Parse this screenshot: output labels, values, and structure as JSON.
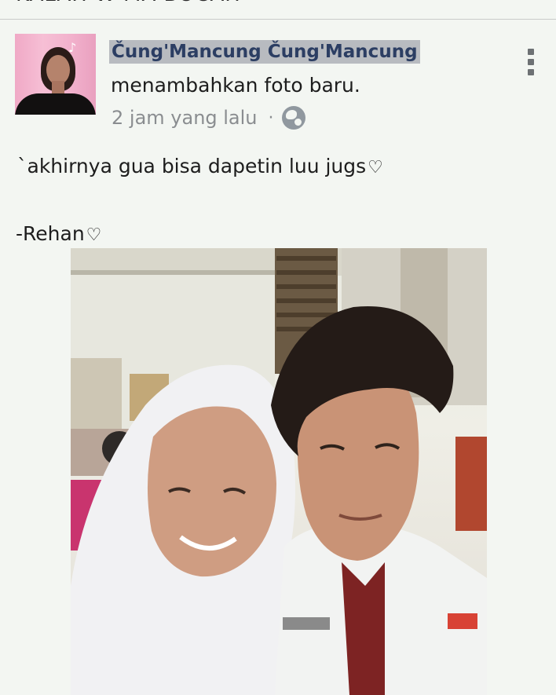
{
  "top_cut_text": "KALAH W MA BOCAH",
  "post": {
    "author": "Čung'Mancung Čung'Mancung",
    "action": "menambahkan foto baru.",
    "time": "2 jam yang lalu",
    "separator": "·",
    "caption_line1": "`akhirnya gua bisa dapetin luu jugs",
    "caption_line2": "-Rehan",
    "heart_glyph": "♡"
  },
  "icons": {
    "privacy": "globe-icon",
    "menu": "more-vertical-icon"
  },
  "colors": {
    "background": "#f3f6f2",
    "name": "#2c3e63",
    "meta": "#8a8d90"
  }
}
